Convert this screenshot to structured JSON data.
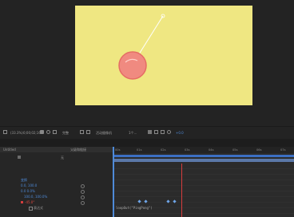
{
  "viewer": {
    "background_color": "#efe782",
    "ball_color": "#f08a80",
    "ball_outline": "#e56d64",
    "string_color": "#ffffff"
  },
  "viewer_toolbar": {
    "zoom_label": "(33.3%)",
    "time_label": "0;00;02;16",
    "quality_label": "完整",
    "camera_label": "活动摄像机",
    "views_label": "1个...",
    "exposure_label": "+0.0"
  },
  "timeline": {
    "header_label": "Untitled",
    "column_header": "父级和链接",
    "parent_label": "无",
    "rows": [
      {
        "label": "变换",
        "kind": "group"
      },
      {
        "label": "0.0, 100.0",
        "kind": "prop"
      },
      {
        "label": "0.0 0.0%",
        "kind": "prop"
      },
      {
        "label": "100.0, 100.0%",
        "kind": "prop"
      },
      {
        "label": "-45.0°",
        "kind": "rotation"
      },
      {
        "label": "表达式",
        "kind": "expression"
      }
    ],
    "ruler_ticks": [
      "00s",
      "01s",
      "02s",
      "03s",
      "04s",
      "05s",
      "06s",
      "07s"
    ],
    "expression_text": "loopOut(\"PingPong\")",
    "accent_color": "#4e8ad8",
    "playhead_color": "#d63d3d"
  }
}
